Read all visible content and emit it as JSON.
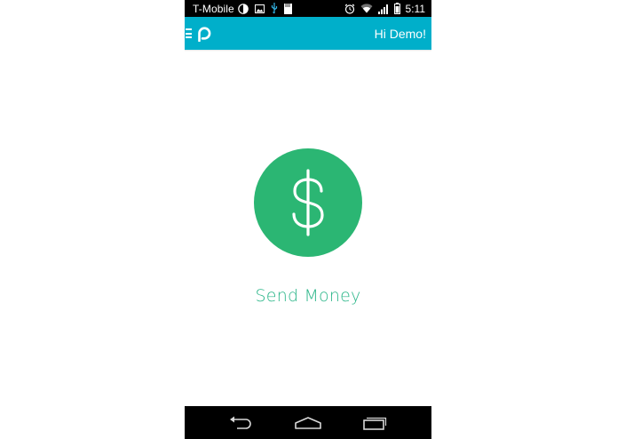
{
  "status_bar": {
    "carrier": "T-Mobile",
    "time": "5:11",
    "icons_left": [
      "moon-phase-icon",
      "image-icon",
      "usb-icon",
      "sd-card-icon"
    ],
    "icons_right": [
      "alarm-icon",
      "wifi-icon",
      "signal-icon",
      "battery-icon"
    ]
  },
  "app_bar": {
    "greeting": "Hi Demo!",
    "icons": [
      "menu-icon",
      "logo-icon"
    ],
    "color": "#00afca"
  },
  "main": {
    "action_icon": "dollar-icon",
    "action_color": "#2bb673",
    "action_label": "Send Money"
  },
  "nav_bar": {
    "buttons": [
      "back-icon",
      "home-icon",
      "recents-icon"
    ]
  }
}
